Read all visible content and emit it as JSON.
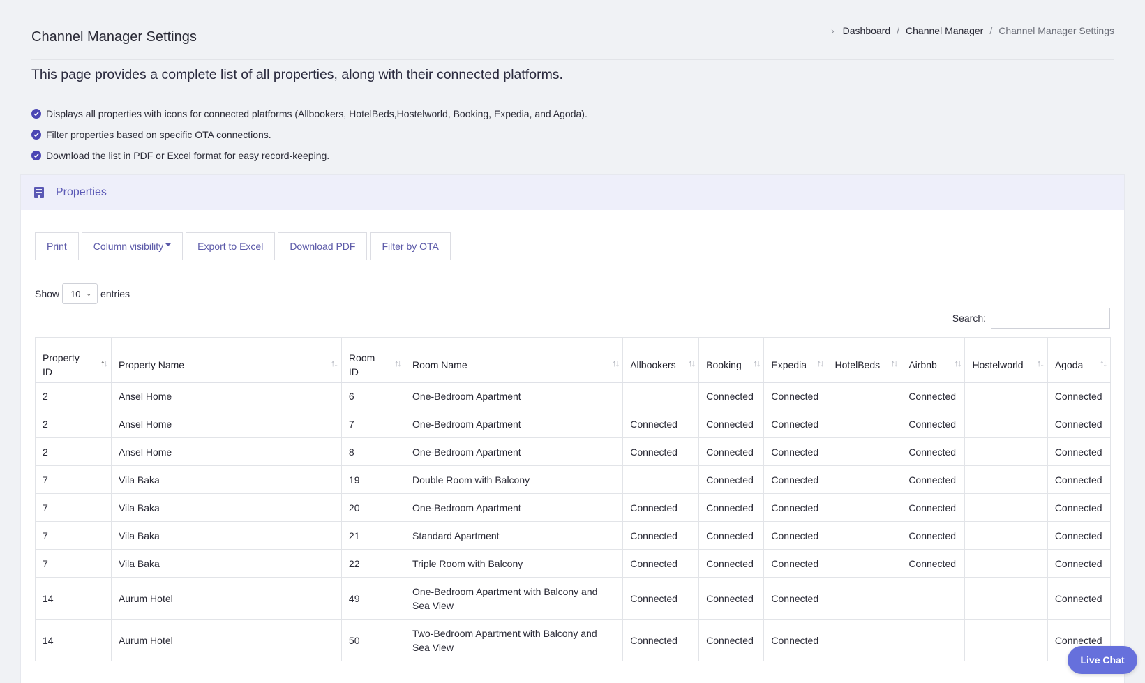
{
  "header": {
    "title": "Channel Manager Settings",
    "breadcrumb": {
      "item1": "Dashboard",
      "item2": "Channel Manager",
      "current": "Channel Manager Settings"
    }
  },
  "intro": "This page provides a complete list of all properties, along with their connected platforms.",
  "features": [
    "Displays all properties with icons for connected platforms (Allbookers, HotelBeds,Hostelworld, Booking, Expedia, and Agoda).",
    "Filter properties based on specific OTA connections.",
    "Download the list in PDF or Excel format for easy record-keeping."
  ],
  "card": {
    "title": "Properties",
    "icon": "building-icon"
  },
  "toolbar": {
    "print": "Print",
    "column_visibility": "Column visibility",
    "export_excel": "Export to Excel",
    "download_pdf": "Download PDF",
    "filter_ota": "Filter by OTA"
  },
  "length": {
    "show": "Show",
    "value": "10",
    "entries": "entries"
  },
  "search": {
    "label": "Search:",
    "value": ""
  },
  "table": {
    "columns": [
      "Property ID",
      "Property Name",
      "Room ID",
      "Room Name",
      "Allbookers",
      "Booking",
      "Expedia",
      "HotelBeds",
      "Airbnb",
      "Hostelworld",
      "Agoda"
    ],
    "rows": [
      [
        "2",
        "Ansel Home",
        "6",
        "One-Bedroom Apartment",
        "",
        "Connected",
        "Connected",
        "",
        "Connected",
        "",
        "Connected"
      ],
      [
        "2",
        "Ansel Home",
        "7",
        "One-Bedroom Apartment",
        "Connected",
        "Connected",
        "Connected",
        "",
        "Connected",
        "",
        "Connected"
      ],
      [
        "2",
        "Ansel Home",
        "8",
        "One-Bedroom Apartment",
        "Connected",
        "Connected",
        "Connected",
        "",
        "Connected",
        "",
        "Connected"
      ],
      [
        "7",
        "Vila Baka",
        "19",
        "Double Room with Balcony",
        "",
        "Connected",
        "Connected",
        "",
        "Connected",
        "",
        "Connected"
      ],
      [
        "7",
        "Vila Baka",
        "20",
        "One-Bedroom Apartment",
        "Connected",
        "Connected",
        "Connected",
        "",
        "Connected",
        "",
        "Connected"
      ],
      [
        "7",
        "Vila Baka",
        "21",
        "Standard Apartment",
        "Connected",
        "Connected",
        "Connected",
        "",
        "Connected",
        "",
        "Connected"
      ],
      [
        "7",
        "Vila Baka",
        "22",
        "Triple Room with Balcony",
        "Connected",
        "Connected",
        "Connected",
        "",
        "Connected",
        "",
        "Connected"
      ],
      [
        "14",
        "Aurum Hotel",
        "49",
        "One-Bedroom Apartment with Balcony and Sea View",
        "Connected",
        "Connected",
        "Connected",
        "",
        "",
        "",
        "Connected"
      ],
      [
        "14",
        "Aurum Hotel",
        "50",
        "Two-Bedroom Apartment with Balcony and Sea View",
        "Connected",
        "Connected",
        "Connected",
        "",
        "",
        "",
        "Connected"
      ]
    ]
  },
  "live_chat": "Live Chat",
  "colors": {
    "accent": "#4b46b4",
    "live_chat": "#6670dc",
    "card_header": "#eeeffa"
  }
}
